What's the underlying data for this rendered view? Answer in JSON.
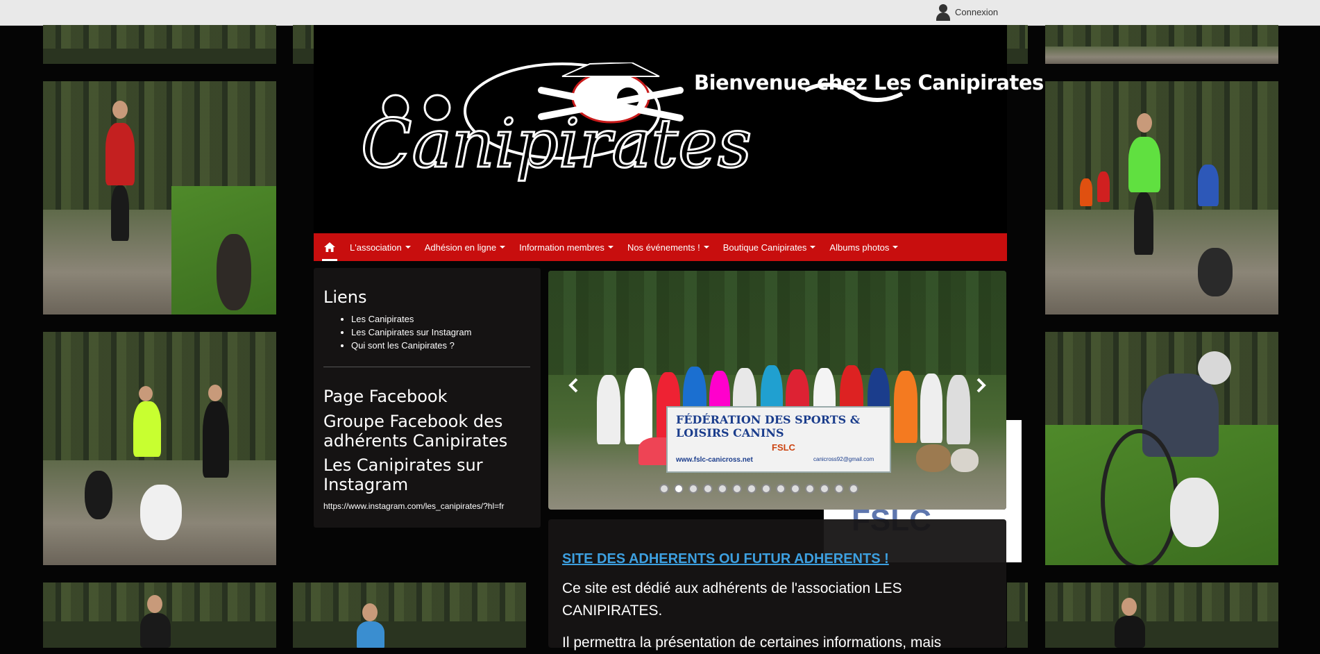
{
  "topbar": {
    "login_label": "Connexion"
  },
  "header": {
    "welcome": "Bienvenue chez Les Canipirates",
    "logo_text": "Canipirates"
  },
  "nav": {
    "items": [
      {
        "label": "L'association"
      },
      {
        "label": "Adhésion en ligne"
      },
      {
        "label": "Information membres"
      },
      {
        "label": "Nos événements !"
      },
      {
        "label": "Boutique Canipirates"
      },
      {
        "label": "Albums photos"
      }
    ]
  },
  "sidebar": {
    "liens_title": "Liens",
    "liens": [
      {
        "label": "Les Canipirates"
      },
      {
        "label": "Les Canipirates sur Instagram"
      },
      {
        "label": "Qui sont les Canipirates ?"
      }
    ],
    "facebook_page": "Page Facebook",
    "facebook_group": "Groupe Facebook des adhérents Canipirates",
    "instagram_title": "Les Canipirates sur Instagram",
    "instagram_url": "https://www.instagram.com/les_canipirates/?hl=fr"
  },
  "slider": {
    "banner_title": "FÉDÉRATION DES SPORTS & LOISIRS CANINS",
    "banner_url": "www.fslc-canicross.net",
    "banner_org": "FSLC",
    "banner_mail": "canicross92@gmail.com",
    "dot_count": 14,
    "active_dot": 1
  },
  "content": {
    "heading_link": "SITE DES ADHERENTS OU FUTUR ADHERENTS !",
    "paragraph1": "Ce site est dédié aux adhérents de l'association LES CANIPIRATES.",
    "paragraph2": "Il permettra la présentation de certaines informations, mais"
  },
  "colors": {
    "nav_red": "#c80e0e",
    "link_blue": "#3da0e0"
  }
}
